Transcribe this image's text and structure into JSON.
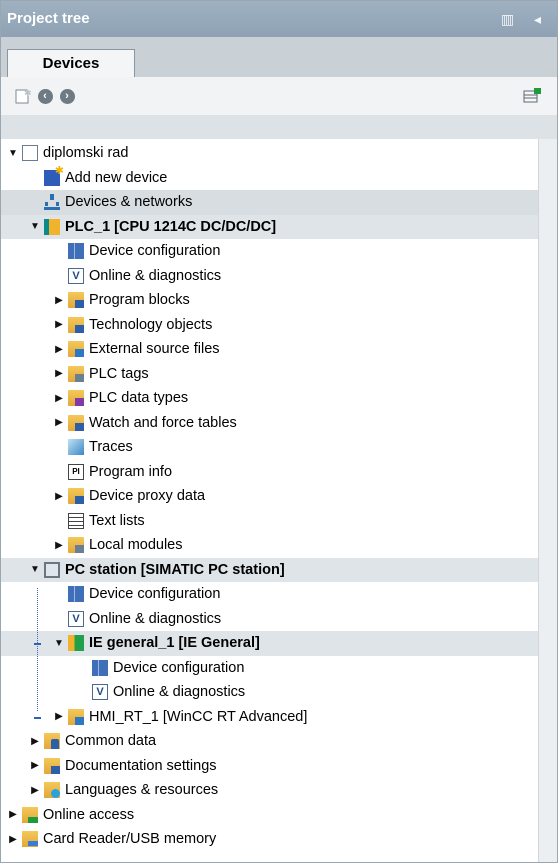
{
  "title_bar": {
    "title": "Project tree",
    "controls": "▥ ◂"
  },
  "tabs": [
    {
      "label": "Devices"
    }
  ],
  "toolbar": {
    "new_icon": "new-item-icon",
    "back_icon": "back-icon",
    "forward_icon": "forward-icon",
    "view_icon": "view-options-icon"
  },
  "tree": [
    {
      "level": 0,
      "toggle": "▼",
      "icon": "doc",
      "label": "diplomski rad"
    },
    {
      "level": 1,
      "toggle": "",
      "icon": "add",
      "label": "Add new device"
    },
    {
      "level": 1,
      "toggle": "",
      "icon": "net",
      "label": "Devices & networks",
      "selected": true
    },
    {
      "level": 1,
      "toggle": "▼",
      "icon": "plc",
      "label": "PLC_1 [CPU 1214C DC/DC/DC]",
      "bold": true,
      "highlight": true
    },
    {
      "level": 2,
      "toggle": "",
      "icon": "cfg",
      "label": "Device configuration"
    },
    {
      "level": 2,
      "toggle": "",
      "icon": "diag",
      "label": "Online & diagnostics"
    },
    {
      "level": 2,
      "toggle": "▶",
      "icon": "folder",
      "label": "Program blocks"
    },
    {
      "level": 2,
      "toggle": "▶",
      "icon": "folder",
      "label": "Technology objects"
    },
    {
      "level": 2,
      "toggle": "▶",
      "icon": "folder",
      "label": "External source files"
    },
    {
      "level": 2,
      "toggle": "▶",
      "icon": "folder",
      "label": "PLC tags"
    },
    {
      "level": 2,
      "toggle": "▶",
      "icon": "folder",
      "label": "PLC data types"
    },
    {
      "level": 2,
      "toggle": "▶",
      "icon": "folder",
      "label": "Watch and force tables"
    },
    {
      "level": 2,
      "toggle": "",
      "icon": "trace",
      "label": "Traces"
    },
    {
      "level": 2,
      "toggle": "",
      "icon": "pinfo",
      "label": "Program info"
    },
    {
      "level": 2,
      "toggle": "▶",
      "icon": "folder",
      "label": "Device proxy data"
    },
    {
      "level": 2,
      "toggle": "",
      "icon": "text",
      "label": "Text lists"
    },
    {
      "level": 2,
      "toggle": "▶",
      "icon": "folder",
      "label": "Local modules"
    },
    {
      "level": 1,
      "toggle": "▼",
      "icon": "pc",
      "label": "PC station [SIMATIC PC station]",
      "bold": true,
      "highlight": true
    },
    {
      "level": 2,
      "toggle": "",
      "icon": "cfg",
      "label": "Device configuration"
    },
    {
      "level": 2,
      "toggle": "",
      "icon": "diag",
      "label": "Online & diagnostics"
    },
    {
      "level": 2,
      "toggle": "▼",
      "icon": "ie",
      "label": "IE general_1 [IE General]",
      "bold": true,
      "highlight": true
    },
    {
      "level": 3,
      "toggle": "",
      "icon": "cfg",
      "label": "Device configuration"
    },
    {
      "level": 3,
      "toggle": "",
      "icon": "diag",
      "label": "Online & diagnostics"
    },
    {
      "level": 2,
      "toggle": "▶",
      "icon": "hmi",
      "label": "HMI_RT_1 [WinCC RT Advanced]"
    },
    {
      "level": 1,
      "toggle": "▶",
      "icon": "common",
      "label": "Common data"
    },
    {
      "level": 1,
      "toggle": "▶",
      "icon": "folder",
      "label": "Documentation settings"
    },
    {
      "level": 1,
      "toggle": "▶",
      "icon": "lang",
      "label": "Languages & resources"
    },
    {
      "level": 0,
      "toggle": "▶",
      "icon": "online",
      "label": "Online access"
    },
    {
      "level": 0,
      "toggle": "▶",
      "icon": "card",
      "label": "Card Reader/USB memory"
    }
  ]
}
